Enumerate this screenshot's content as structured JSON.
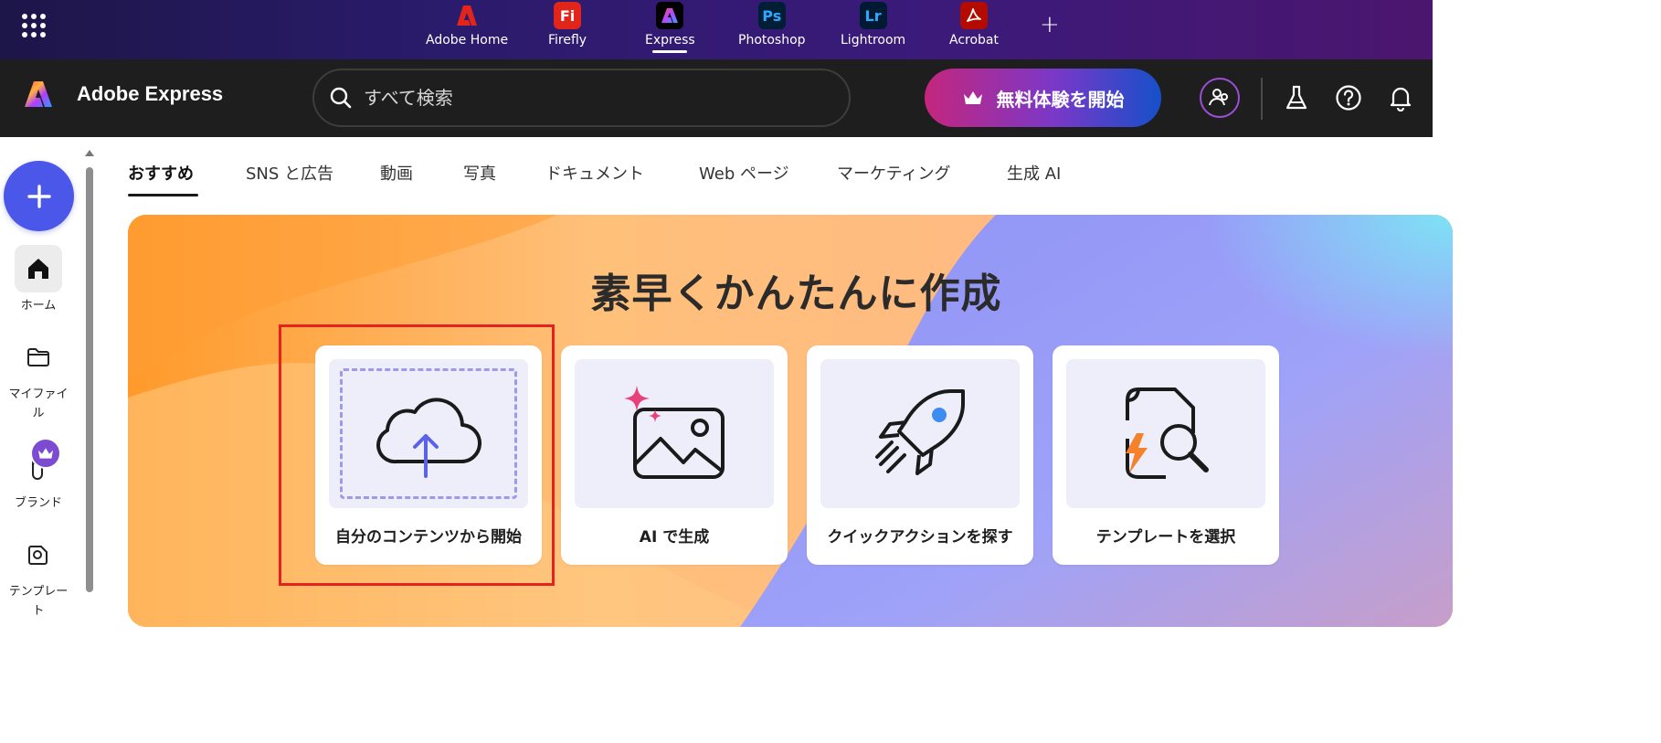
{
  "app_switcher": {
    "apps": [
      {
        "name": "Adobe Home",
        "logo_text": "",
        "color": "#e1251b",
        "active": false
      },
      {
        "name": "Firefly",
        "logo_text": "Fi",
        "color": "#e1251b",
        "active": false
      },
      {
        "name": "Express",
        "logo_text": "",
        "color": "#000000",
        "active": true
      },
      {
        "name": "Photoshop",
        "logo_text": "Ps",
        "color": "#001e36",
        "active": false
      },
      {
        "name": "Lightroom",
        "logo_text": "Lr",
        "color": "#001a33",
        "active": false
      },
      {
        "name": "Acrobat",
        "logo_text": "",
        "color": "#b30b00",
        "active": false
      }
    ],
    "add_label": "+"
  },
  "header": {
    "brand_name": "Adobe Express",
    "search_placeholder": "すべて検索",
    "trial_button": "無料体験を開始"
  },
  "rail": {
    "items": [
      {
        "label": "ホーム",
        "icon": "home-icon"
      },
      {
        "label": "マイファイル",
        "icon": "folder-icon"
      },
      {
        "label": "ブランド",
        "icon": "brand-icon"
      },
      {
        "label": "テンプレート",
        "icon": "template-icon"
      }
    ]
  },
  "tabs": [
    "おすすめ",
    "SNS と広告",
    "動画",
    "写真",
    "ドキュメント",
    "Web ページ",
    "マーケティング",
    "生成 AI"
  ],
  "hero": {
    "title": "素早くかんたんに作成",
    "cards": [
      {
        "caption": "自分のコンテンツから開始",
        "icon": "upload-cloud-icon"
      },
      {
        "caption": "AI で生成",
        "icon": "ai-image-icon"
      },
      {
        "caption": "クイックアクションを探す",
        "icon": "rocket-icon"
      },
      {
        "caption": "テンプレートを選択",
        "icon": "template-search-icon"
      }
    ]
  },
  "colors": {
    "accent": "#4b57e8",
    "highlight_box": "#e5221f"
  }
}
